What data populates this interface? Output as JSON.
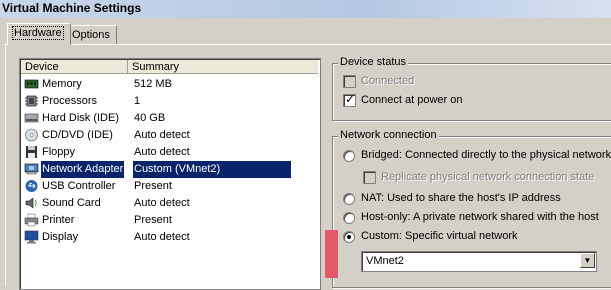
{
  "window": {
    "title": "Virtual Machine Settings"
  },
  "tabs": [
    {
      "label": "Hardware"
    },
    {
      "label": "Options"
    }
  ],
  "device_list": {
    "columns": [
      "Device",
      "Summary"
    ],
    "rows": [
      {
        "device": "Memory",
        "summary": "512 MB",
        "icon": "memory-icon"
      },
      {
        "device": "Processors",
        "summary": "1",
        "icon": "processor-icon"
      },
      {
        "device": "Hard Disk (IDE)",
        "summary": "40 GB",
        "icon": "hard-disk-icon"
      },
      {
        "device": "CD/DVD (IDE)",
        "summary": "Auto detect",
        "icon": "cd-dvd-icon"
      },
      {
        "device": "Floppy",
        "summary": "Auto detect",
        "icon": "floppy-icon"
      },
      {
        "device": "Network Adapter",
        "summary": "Custom (VMnet2)",
        "icon": "network-adapter-icon",
        "selected": true
      },
      {
        "device": "USB Controller",
        "summary": "Present",
        "icon": "usb-icon"
      },
      {
        "device": "Sound Card",
        "summary": "Auto detect",
        "icon": "sound-card-icon"
      },
      {
        "device": "Printer",
        "summary": "Present",
        "icon": "printer-icon"
      },
      {
        "device": "Display",
        "summary": "Auto detect",
        "icon": "display-icon"
      }
    ]
  },
  "device_status": {
    "title": "Device status",
    "connected": {
      "label": "Connected",
      "checked": false,
      "disabled": true
    },
    "connect_at_power_on": {
      "label": "Connect at power on",
      "checked": true
    }
  },
  "network_connection": {
    "title": "Network connection",
    "bridged": "Bridged: Connected directly to the physical network",
    "replicate": "Replicate physical network connection state",
    "nat": "NAT: Used to share the host's IP address",
    "host_only": "Host-only: A private network shared with the host",
    "custom": "Custom: Specific virtual network",
    "selected": "custom",
    "custom_network": "VMnet2"
  },
  "colors": {
    "selection": "#0a246a",
    "title_gradient": "#b4c8e3",
    "marker": "#e35a6a"
  }
}
